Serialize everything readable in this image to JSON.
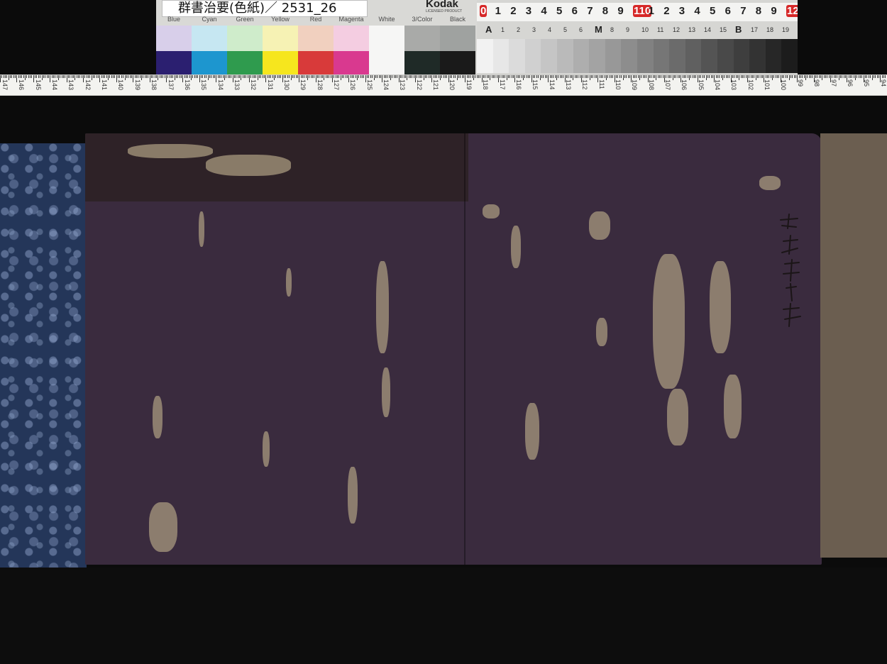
{
  "color_card": {
    "label": "群書治要(色紙)／ 2531_26",
    "brand": "Kodak",
    "brand_sub": "LICENSED PRODUCT",
    "swatches": [
      {
        "name": "Blue",
        "top_color": "#d8cfea",
        "bottom_color": "#2b1f70"
      },
      {
        "name": "Cyan",
        "top_color": "#c6e7f2",
        "bottom_color": "#1d96cf"
      },
      {
        "name": "Green",
        "top_color": "#cfeccb",
        "bottom_color": "#2f9b4e"
      },
      {
        "name": "Yellow",
        "top_color": "#f6f2b4",
        "bottom_color": "#f6e61e"
      },
      {
        "name": "Red",
        "top_color": "#f1d0bf",
        "bottom_color": "#d83a3a"
      },
      {
        "name": "Magenta",
        "top_color": "#f4cde1",
        "bottom_color": "#d9398f"
      },
      {
        "name": "White",
        "top_color": "#f6f6f5",
        "bottom_color": "#f6f6f5"
      },
      {
        "name": "3/Color",
        "top_color": "#a9aaa8",
        "bottom_color": "#1f2a27"
      },
      {
        "name": "Black",
        "top_color": "#9fa2a0",
        "bottom_color": "#1a1a1a"
      }
    ]
  },
  "grey_scale": {
    "ruler_numbers": [
      "0",
      "1",
      "2",
      "3",
      "4",
      "5",
      "6",
      "7",
      "8",
      "9",
      "110",
      "1",
      "2",
      "3",
      "4",
      "5",
      "6",
      "7",
      "8",
      "9",
      "12"
    ],
    "patch_labels": [
      "A",
      "1",
      "2",
      "3",
      "4",
      "5",
      "6",
      "M",
      "8",
      "9",
      "10",
      "11",
      "12",
      "13",
      "14",
      "15",
      "B",
      "17",
      "18",
      "19"
    ]
  },
  "ruler": {
    "numbers": [
      "147",
      "146",
      "145",
      "144",
      "143",
      "142",
      "141",
      "140",
      "139",
      "138",
      "137",
      "136",
      "135",
      "134",
      "133",
      "132",
      "131",
      "130",
      "129",
      "128",
      "127",
      "126",
      "125",
      "124",
      "123",
      "122",
      "121",
      "120",
      "119",
      "118",
      "117",
      "116",
      "115",
      "114",
      "113",
      "112",
      "111",
      "110",
      "109",
      "108",
      "107",
      "106",
      "105",
      "104",
      "103",
      "102",
      "101",
      "100",
      "99",
      "98",
      "97",
      "96",
      "95",
      "94",
      "93",
      "92"
    ]
  },
  "colors": {
    "paper": "#3a2b3e",
    "brocade": "#243659",
    "mount": "#6b5e50",
    "wear": "#a8997f"
  }
}
